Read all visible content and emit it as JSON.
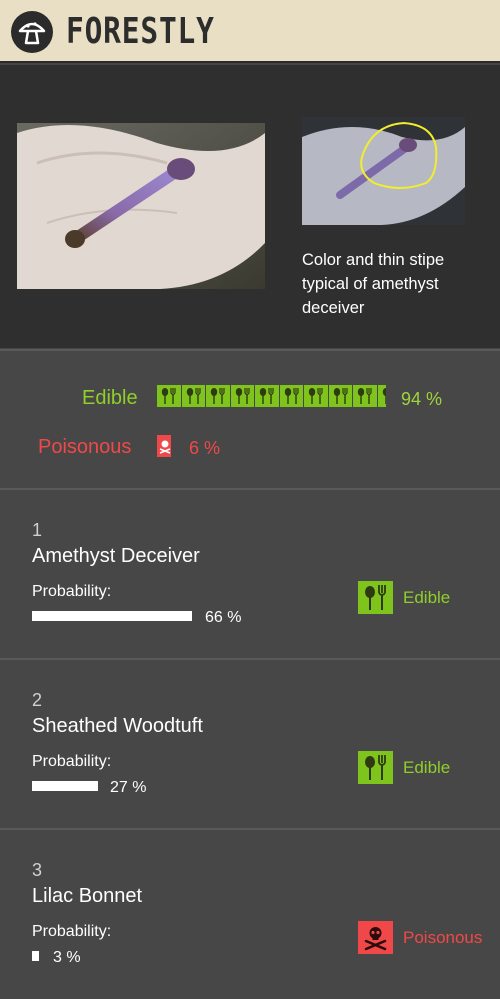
{
  "app": {
    "brand": "FORESTLY",
    "logo_icon": "mushroom-icon"
  },
  "analysis": {
    "caption": "Color and thin stipe typical of amethyst deceiver"
  },
  "summary": {
    "edible_label": "Edible",
    "edible_percent": "94 %",
    "edible_fraction": 0.94,
    "poisonous_label": "Poisonous",
    "poisonous_percent": "6 %",
    "poisonous_fraction": 0.06
  },
  "results": [
    {
      "rank": "1",
      "name": "Amethyst Deceiver",
      "probability_label": "Probability:",
      "probability": "66 %",
      "probability_fraction": 0.66,
      "edibility": "Edible",
      "edibility_icon": "fork-spoon-icon"
    },
    {
      "rank": "2",
      "name": "Sheathed Woodtuft",
      "probability_label": "Probability:",
      "probability": "27 %",
      "probability_fraction": 0.27,
      "edibility": "Edible",
      "edibility_icon": "fork-spoon-icon"
    },
    {
      "rank": "3",
      "name": "Lilac Bonnet",
      "probability_label": "Probability:",
      "probability": "3 %",
      "probability_fraction": 0.03,
      "edibility": "Poisonous",
      "edibility_icon": "skull-crossbones-icon"
    }
  ],
  "colors": {
    "edible": "#7fc31d",
    "poisonous": "#f04848",
    "header": "#e9dfc4"
  }
}
